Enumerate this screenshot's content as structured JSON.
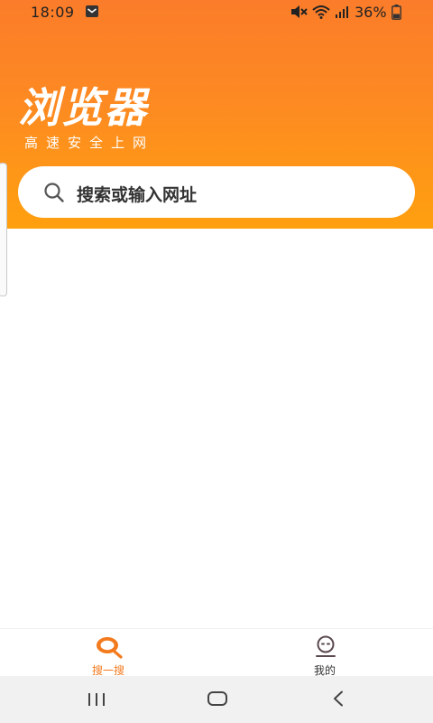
{
  "status_bar": {
    "time": "18:09",
    "battery_percent": "36%",
    "icons": [
      "mail-icon",
      "mute-icon",
      "wifi-icon",
      "signal-icon",
      "battery-icon"
    ]
  },
  "header": {
    "title": "浏览器",
    "subtitle": "高速安全上网"
  },
  "search": {
    "placeholder": "搜索或输入网址"
  },
  "tab_bar": {
    "tabs": [
      {
        "label": "搜一搜",
        "icon": "search-tab-icon",
        "active": true
      },
      {
        "label": "我的",
        "icon": "face-icon",
        "active": false
      }
    ]
  },
  "system_nav": {
    "buttons": [
      "recent-apps-button",
      "home-button",
      "back-button"
    ]
  },
  "colors": {
    "brand_top": "#fb7c2a",
    "brand_bottom": "#ffa00f",
    "active_tab": "#f47a1e"
  }
}
